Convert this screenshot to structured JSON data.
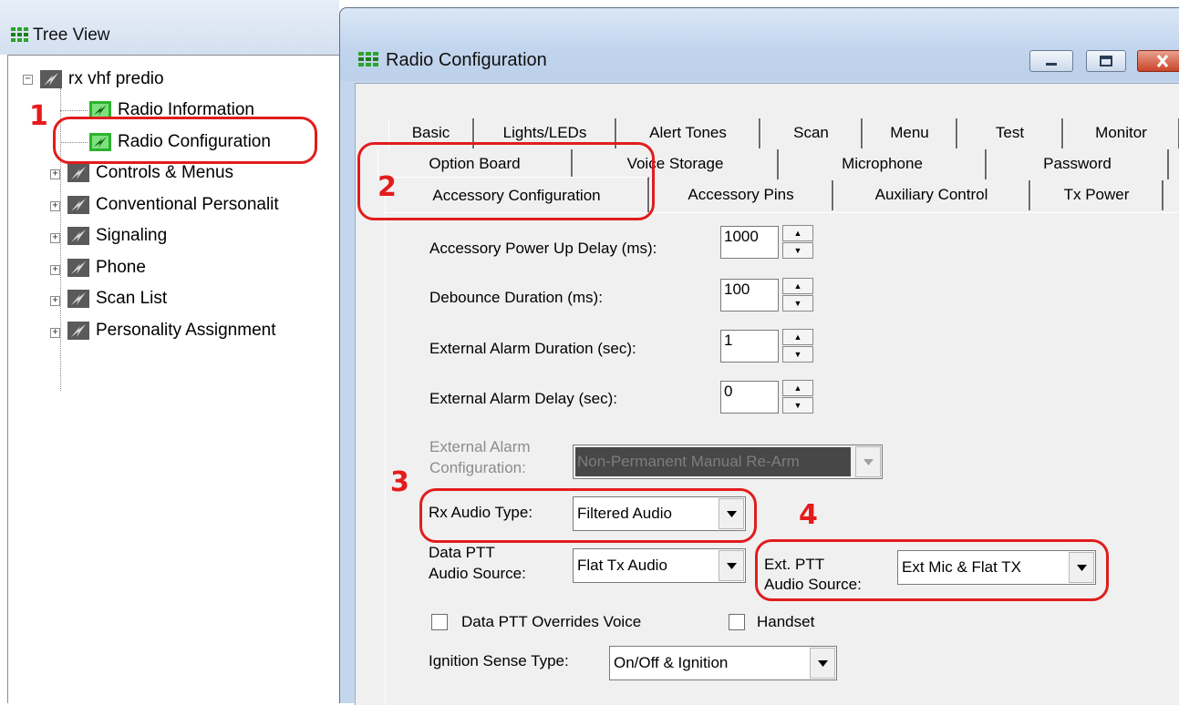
{
  "colors": {
    "annotation": "#e11d1d",
    "window_frame": "#c4d6ec",
    "dialog_bg": "#f0f0f0"
  },
  "tree_view": {
    "title": "Tree View",
    "root": "rx vhf predio",
    "items": [
      {
        "label": "Radio Information",
        "expandable": false
      },
      {
        "label": "Radio Configuration",
        "expandable": false
      },
      {
        "label": "Controls & Menus",
        "expandable": true
      },
      {
        "label": "Conventional Personalit",
        "expandable": true
      },
      {
        "label": "Signaling",
        "expandable": true
      },
      {
        "label": "Phone",
        "expandable": true
      },
      {
        "label": "Scan List",
        "expandable": true
      },
      {
        "label": "Personality Assignment",
        "expandable": true
      }
    ]
  },
  "window": {
    "title": "Radio Configuration"
  },
  "tabs": {
    "row1": [
      "Basic",
      "Lights/LEDs",
      "Alert Tones",
      "Scan",
      "Menu",
      "Test",
      "Monitor"
    ],
    "row2": [
      "Option Board",
      "Voice Storage",
      "Microphone",
      "Password"
    ],
    "row3": [
      "Accessory Configuration",
      "Accessory Pins",
      "Auxiliary Control",
      "Tx Power"
    ],
    "active": "Accessory Configuration"
  },
  "form": {
    "power_up_delay": {
      "label": "Accessory Power Up Delay (ms):",
      "value": "1000"
    },
    "debounce": {
      "label": "Debounce Duration (ms):",
      "value": "100"
    },
    "alarm_duration": {
      "label": "External Alarm Duration (sec):",
      "value": "1"
    },
    "alarm_delay": {
      "label": "External Alarm Delay (sec):",
      "value": "0"
    },
    "alarm_config": {
      "label1": "External Alarm",
      "label2": "Configuration:",
      "value": "Non-Permanent Manual Re-Arm"
    },
    "rx_audio_type": {
      "label": "Rx Audio Type:",
      "value": "Filtered Audio"
    },
    "data_ptt_source": {
      "label1": "Data PTT",
      "label2": "Audio Source:",
      "value": "Flat Tx Audio"
    },
    "ext_ptt_source": {
      "label1": "Ext. PTT",
      "label2": "Audio Source:",
      "value": "Ext Mic & Flat TX"
    },
    "data_ptt_overrides": {
      "label": "Data PTT Overrides Voice",
      "checked": false
    },
    "handset": {
      "label": "Handset",
      "checked": false
    },
    "ignition_sense": {
      "label": "Ignition Sense Type:",
      "value": "On/Off & Ignition"
    }
  },
  "annotations": {
    "n1": "1",
    "n2": "2",
    "n3": "3",
    "n4": "4"
  }
}
